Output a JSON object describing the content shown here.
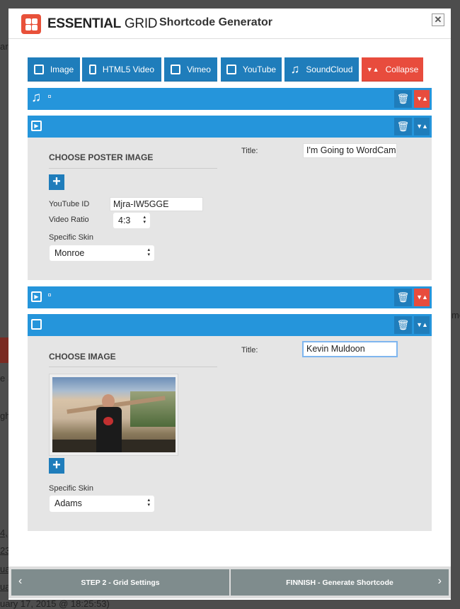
{
  "background_fragments": [
    "ard",
    "me",
    "e S",
    "gh",
    "4,",
    "23,",
    "ua",
    "ua",
    "uary 17, 2015 @ 18:25:53)"
  ],
  "header": {
    "brand_bold": "ESSENTIAL",
    "brand_light": " GRID",
    "title": "Shortcode Generator",
    "close_icon": "close-icon"
  },
  "toolbar": [
    {
      "label": "Image",
      "icon": "image-icon"
    },
    {
      "label": "HTML5 Video",
      "icon": "film-icon"
    },
    {
      "label": "Vimeo",
      "icon": "video-icon"
    },
    {
      "label": "YouTube",
      "icon": "video-icon"
    },
    {
      "label": "SoundCloud",
      "icon": "music-icon"
    },
    {
      "label": "Collapse",
      "icon": "collapse-icon"
    }
  ],
  "items": [
    {
      "type": "soundcloud",
      "collapsed": true
    },
    {
      "type": "youtube",
      "collapsed": false,
      "section_title": "CHOOSE POSTER IMAGE",
      "youtube_id_label": "YouTube ID",
      "youtube_id": "Mjra-IW5GGE",
      "ratio_label": "Video Ratio",
      "ratio": "4:3",
      "skin_label": "Specific Skin",
      "skin": "Monroe",
      "title_label": "Title:",
      "title": "I'm Going to WordCam"
    },
    {
      "type": "vimeo",
      "collapsed": true
    },
    {
      "type": "image",
      "collapsed": false,
      "section_title": "CHOOSE IMAGE",
      "skin_label": "Specific Skin",
      "skin": "Adams",
      "title_label": "Title:",
      "title": "Kevin Muldoon"
    }
  ],
  "footer": {
    "back": "STEP 2 - Grid Settings",
    "next": "FINNISH - Generate Shortcode"
  },
  "colors": {
    "blue": "#2595db",
    "dark_blue": "#1f7dbb",
    "red": "#e84c3d",
    "footer": "#7f8c8d",
    "panel": "#e5e5e5"
  }
}
